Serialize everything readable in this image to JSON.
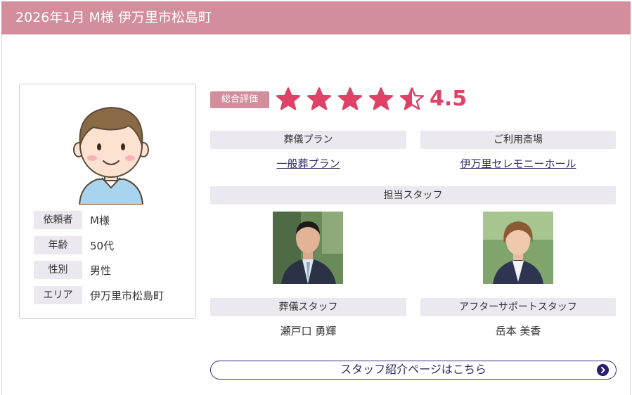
{
  "header": {
    "title": "2026年1月 M様 伊万里市松島町"
  },
  "profile": {
    "rows": [
      {
        "label": "依頼者",
        "value": "M様"
      },
      {
        "label": "年齢",
        "value": "50代"
      },
      {
        "label": "性別",
        "value": "男性"
      },
      {
        "label": "エリア",
        "value": "伊万里市松島町"
      }
    ]
  },
  "rating": {
    "badge": "総合評価",
    "value": "4.5",
    "score": 4.5,
    "max": 5,
    "star_color": "#de4266"
  },
  "plan": {
    "heading": "葬儀プラン",
    "value": "一般葬プラン"
  },
  "venue": {
    "heading": "ご利用斎場",
    "value": "伊万里セレモニーホール"
  },
  "staff": {
    "heading": "担当スタッフ",
    "members": [
      {
        "role": "葬儀スタッフ",
        "name": "瀬戸口 勇輝"
      },
      {
        "role": "アフターサポートスタッフ",
        "name": "岳本 美香"
      }
    ]
  },
  "cta": {
    "label": "スタッフ紹介ページはこちら",
    "icon": "chevron-right-circle-icon"
  },
  "colors": {
    "header": "#d28e9c",
    "label_bg": "#ebe8f0",
    "accent": "#2b1f6e"
  }
}
